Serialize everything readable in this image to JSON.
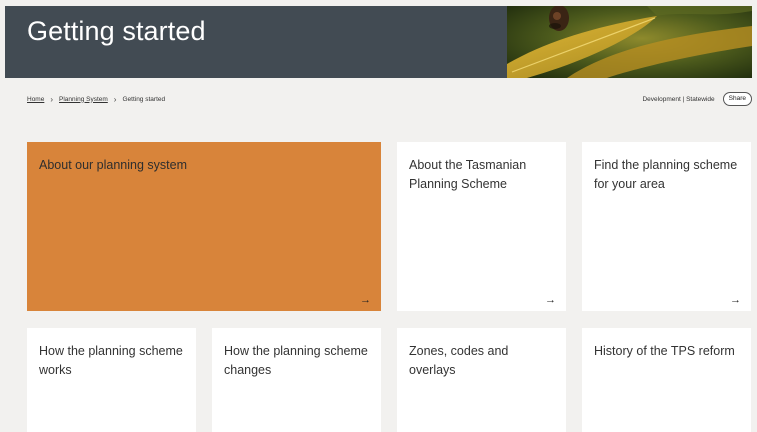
{
  "header": {
    "title": "Getting started"
  },
  "breadcrumb": {
    "items": [
      "Home",
      "Planning System"
    ],
    "current": "Getting started",
    "separator": "›"
  },
  "meta": {
    "tags": "Development | Statewide",
    "share_label": "Share"
  },
  "cards": {
    "c0": {
      "title": "About our planning system",
      "arrow": "→"
    },
    "c1": {
      "title": "About the Tasmanian Planning Scheme",
      "arrow": "→"
    },
    "c2": {
      "title": "Find the planning scheme for your area",
      "arrow": "→"
    },
    "c3": {
      "title": "How the planning scheme works"
    },
    "c4": {
      "title": "How the planning scheme changes"
    },
    "c5": {
      "title": "Zones, codes and overlays"
    },
    "c6": {
      "title": "History of the TPS reform"
    }
  },
  "colors": {
    "header_bg": "#424b53",
    "featured_card": "#d8843a",
    "page_bg": "#f2f1ef"
  }
}
